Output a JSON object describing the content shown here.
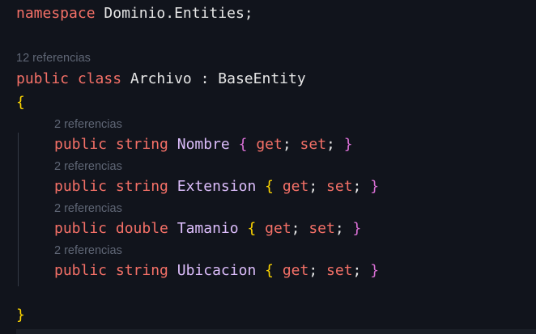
{
  "editor": {
    "line1": {
      "kw": "namespace",
      "name": "Dominio.Entities",
      "semi": ";"
    },
    "refs_class": "12 referencias",
    "class_line": {
      "kw1": "public",
      "kw2": "class",
      "name": "Archivo",
      "colon": ":",
      "base": "BaseEntity"
    },
    "open_brace": "{",
    "close_brace": "}",
    "properties": [
      {
        "refs": "2 referencias",
        "mod": "public",
        "type": "string",
        "name": "Nombre",
        "ob": "{",
        "get": "get",
        "set": "set",
        "cb": "}"
      },
      {
        "refs": "2 referencias",
        "mod": "public",
        "type": "string",
        "name": "Extension",
        "ob": "{",
        "get": "get",
        "set": "set",
        "cb": "}"
      },
      {
        "refs": "2 referencias",
        "mod": "public",
        "type": "double",
        "name": "Tamanio",
        "ob": "{",
        "get": "get",
        "set": "set",
        "cb": "}"
      },
      {
        "refs": "2 referencias",
        "mod": "public",
        "type": "string",
        "name": "Ubicacion",
        "ob": "{",
        "get": "get",
        "set": "set",
        "cb": "}"
      }
    ]
  }
}
